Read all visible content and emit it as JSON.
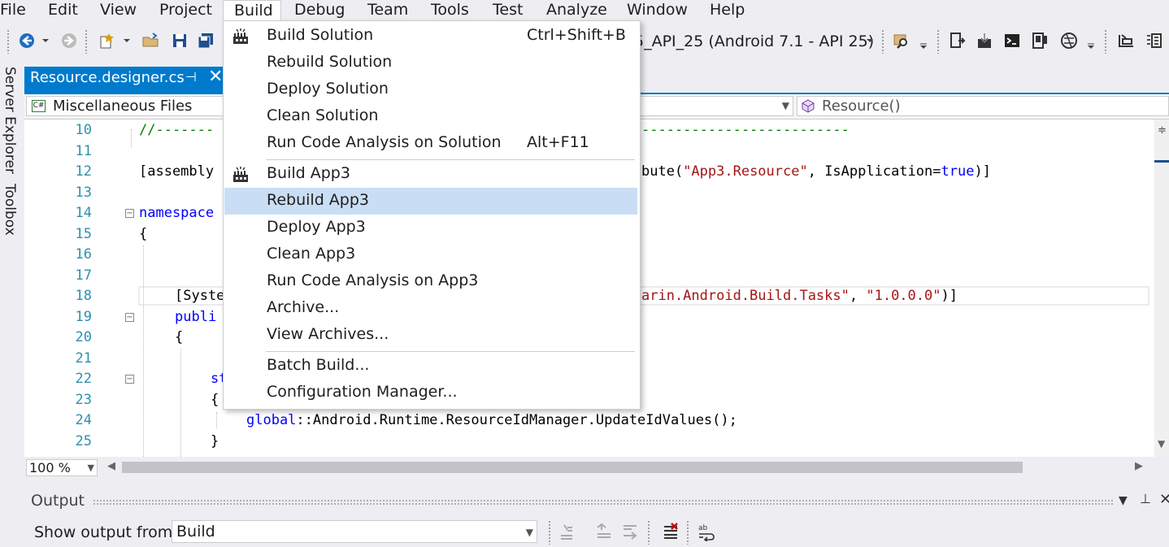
{
  "menubar": {
    "items": [
      "File",
      "Edit",
      "View",
      "Project",
      "Build",
      "Debug",
      "Team",
      "Tools",
      "Test",
      "Analyze",
      "Window",
      "Help"
    ],
    "active": "Build"
  },
  "toolbar": {
    "device_target": "5_API_25 (Android 7.1 - API 25)"
  },
  "side_strip": {
    "server_explorer": "Server Explorer",
    "toolbox": "Toolbox"
  },
  "doc_tab": {
    "title": "Resource.designer.cs",
    "pin_icon": "pin-icon",
    "close_icon": "close-icon"
  },
  "navbar": {
    "project_combo": "Miscellaneous Files",
    "project_icon_text": "C#",
    "member_combo": "Resource()"
  },
  "editor": {
    "line_numbers": [
      "10",
      "11",
      "12",
      "13",
      "14",
      "15",
      "16",
      "17",
      "18",
      "19",
      "20",
      "21",
      "22",
      "23",
      "24",
      "25"
    ],
    "visible_fragments": {
      "l10": "//-------",
      "l10_right": "-------------------------",
      "l12_left": "[assembly",
      "l12_right_pre": "bute(",
      "l12_str": "\"App3.Resource\"",
      "l12_mid": ", IsApplication=",
      "l12_kw": "true",
      "l12_end": ")]",
      "l14": "namespace",
      "l15": "{",
      "l18_left": "[Syste",
      "l18_str1": "arin.Android.Build.Tasks\"",
      "l18_sep": ", ",
      "l18_str2": "\"1.0.0.0\"",
      "l18_end": ")]",
      "l19": "publi",
      "l20": "{",
      "l22": "st",
      "l23": "{",
      "l24_kw": "global",
      "l24_rest": "::Android.Runtime.ResourceIdManager.UpdateIdValues();",
      "l25": "}"
    }
  },
  "zoom": "100 %",
  "output": {
    "title": "Output",
    "show_label": "Show output from:",
    "source": "Build"
  },
  "build_menu": {
    "items": [
      {
        "label": "Build Solution",
        "shortcut": "Ctrl+Shift+B",
        "icon": "build-icon"
      },
      {
        "label": "Rebuild Solution",
        "shortcut": ""
      },
      {
        "label": "Deploy Solution",
        "shortcut": ""
      },
      {
        "label": "Clean Solution",
        "shortcut": ""
      },
      {
        "label": "Run Code Analysis on Solution",
        "shortcut": "Alt+F11"
      },
      {
        "label": "Build App3",
        "shortcut": "",
        "icon": "build-icon"
      },
      {
        "label": "Rebuild App3",
        "shortcut": "",
        "highlighted": true
      },
      {
        "label": "Deploy App3",
        "shortcut": ""
      },
      {
        "label": "Clean App3",
        "shortcut": ""
      },
      {
        "label": "Run Code Analysis on App3",
        "shortcut": ""
      },
      {
        "label": "Archive...",
        "shortcut": ""
      },
      {
        "label": "View Archives...",
        "shortcut": ""
      },
      {
        "label": "Batch Build...",
        "shortcut": ""
      },
      {
        "label": "Configuration Manager...",
        "shortcut": ""
      }
    ]
  },
  "colors": {
    "accent": "#007acc",
    "menu_highlight": "#c9def5",
    "keyword": "#0000ff",
    "string": "#a31515",
    "comment": "#008000",
    "line_number": "#2b91af"
  }
}
